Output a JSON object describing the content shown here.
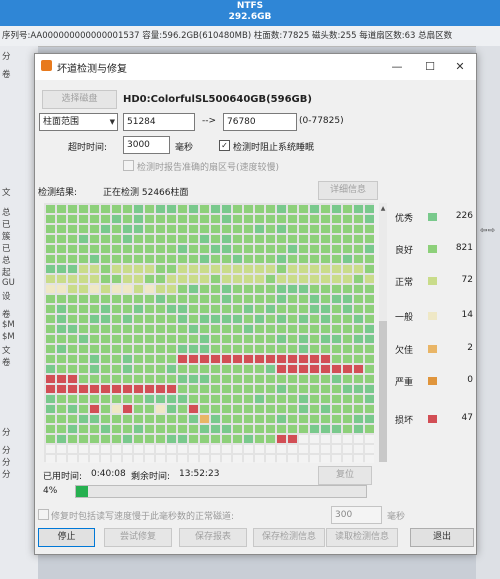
{
  "background": {
    "fs_label": "NTFS",
    "capacity": "292.6GB",
    "info_bar": "序列号:AA000000000000001537   容量:596.2GB(610480MB)  柱面数:77825   磁头数:255   每道扇区数:63   总扇区数",
    "side_labels": [
      "分",
      "卷",
      "文",
      "总",
      "已",
      "簇",
      "已",
      "总",
      "起",
      "GU",
      "设",
      "卷",
      "$M",
      "$M",
      "文",
      "卷",
      "分",
      "分",
      "分",
      "分"
    ],
    "right_arrows": "⇦⇨"
  },
  "dialog": {
    "title": "坏道检测与修复",
    "window_controls": {
      "minimize": "—",
      "maximize": "☐",
      "close": "✕"
    },
    "select_disk_label": "选择磁盘",
    "disk_name": "HD0:ColorfulSL500640GB(596GB)",
    "range_mode": "柱面范围",
    "range_start": "51284",
    "range_arrow": "-->",
    "range_end": "76780",
    "range_total": "(0-77825)",
    "timeout_label": "超时时间:",
    "timeout_value": "3000",
    "timeout_unit": "毫秒",
    "prevent_sleep_label": "检测时阻止系统睡眠",
    "prevent_sleep_checked": true,
    "report_sectors_label": "检测时报告准确的扇区号(速度较慢)",
    "result_label": "检测结果:",
    "status_text": "正在检测 52466柱面",
    "details_button": "详细信息",
    "legend": [
      {
        "label": "优秀",
        "color": "#79c98c",
        "count": "226"
      },
      {
        "label": "良好",
        "color": "#8dd07a",
        "count": "821"
      },
      {
        "label": "正常",
        "color": "#c9dc8a",
        "count": "72"
      },
      {
        "label": "一般",
        "color": "#efe8c6",
        "count": "14"
      },
      {
        "label": "欠佳",
        "color": "#e9b566",
        "count": "2"
      },
      {
        "label": "严重",
        "color": "#e0953c",
        "count": "0"
      },
      {
        "label": "损坏",
        "color": "#d24e55",
        "count": "47"
      }
    ],
    "elapsed_label": "已用时间:",
    "elapsed_value": "0:40:08",
    "remaining_label": "剩余时间:",
    "remaining_value": "13:52:23",
    "reset_button": "复位",
    "progress_text": "4%",
    "progress_value": 0.04,
    "repair_option_label": "修复时包括读写速度慢于此毫秒数的正常磁道:",
    "repair_ms_value": "300",
    "repair_ms_unit": "毫秒",
    "buttons": {
      "stop": "停止",
      "try_repair": "尝试修复",
      "save_report": "保存报表",
      "save_info": "保存检测信息",
      "load_info": "读取检测信息",
      "exit": "退出"
    }
  },
  "chart_data": {
    "type": "table",
    "title": "",
    "categories": [
      "优秀",
      "良好",
      "正常",
      "一般",
      "欠佳",
      "严重",
      "损坏"
    ],
    "values": [
      226,
      821,
      72,
      14,
      2,
      0,
      47
    ]
  }
}
